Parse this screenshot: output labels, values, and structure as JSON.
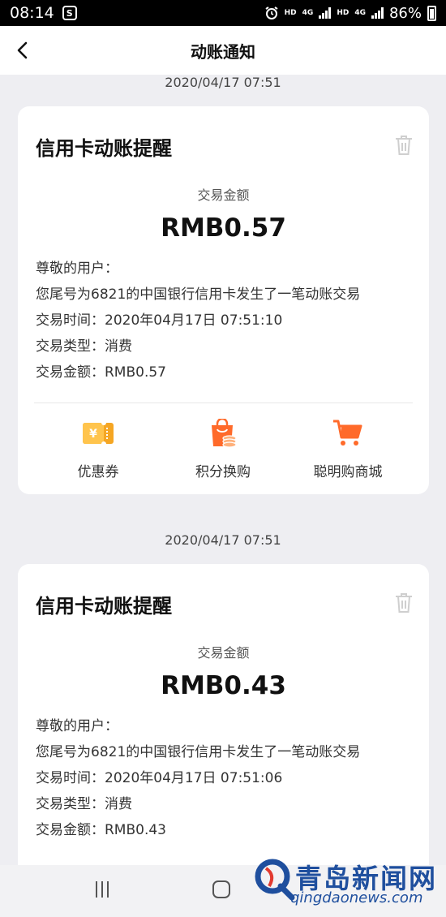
{
  "status_bar": {
    "time": "08:14",
    "app_icon_letter": "S",
    "net1": "HD",
    "net2": "4G",
    "net3": "HD",
    "net4": "4G",
    "battery": "86%"
  },
  "header": {
    "title": "动账通知"
  },
  "notifications": [
    {
      "timestamp": "2020/04/17 07:51",
      "card_title": "信用卡动账提醒",
      "amount_label": "交易金额",
      "amount": "RMB0.57",
      "greeting": "尊敬的用户：",
      "message": "您尾号为6821的中国银行信用卡发生了一笔动账交易",
      "time_line": "交易时间：2020年04月17日 07:51:10",
      "type_line": "交易类型：消费",
      "amount_line": "交易金额：RMB0.57",
      "actions": [
        "优惠券",
        "积分换购",
        "聪明购商城"
      ]
    },
    {
      "timestamp": "2020/04/17 07:51",
      "card_title": "信用卡动账提醒",
      "amount_label": "交易金额",
      "amount": "RMB0.43",
      "greeting": "尊敬的用户：",
      "message": "您尾号为6821的中国银行信用卡发生了一笔动账交易",
      "time_line": "交易时间：2020年04月17日 07:51:06",
      "type_line": "交易类型：消费",
      "amount_line": "交易金额：RMB0.43"
    }
  ],
  "watermark": {
    "text": "青岛新闻网",
    "url": "qingdaonews.com"
  },
  "colors": {
    "accent_orange": "#ff6a2a",
    "coupon_yellow": "#f5a623",
    "watermark_blue": "#1f4f9e"
  }
}
